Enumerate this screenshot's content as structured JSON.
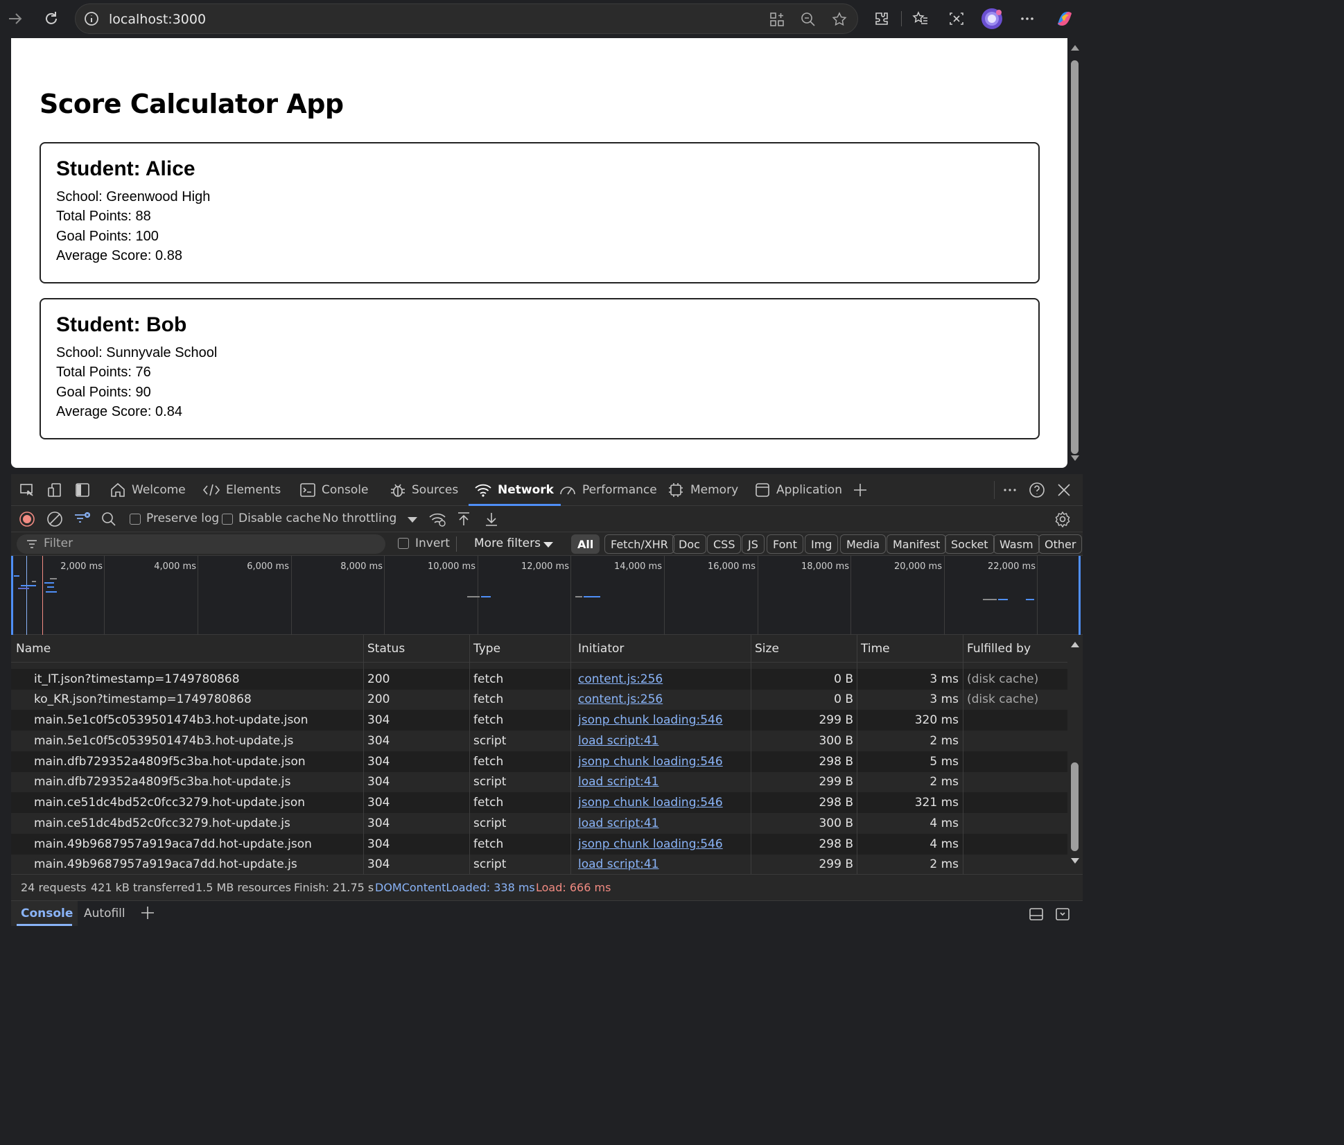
{
  "browser": {
    "url": "localhost:3000",
    "icons": [
      "forward-icon",
      "reload-icon",
      "site-info-icon",
      "app-grid-icon",
      "zoom-out-icon",
      "favorite-star-icon",
      "extensions-icon",
      "favorites-icon",
      "screenshot-icon",
      "profile-avatar",
      "more-icon",
      "copilot-icon"
    ]
  },
  "page": {
    "title": "Score Calculator App",
    "students": [
      {
        "heading": "Student: Alice",
        "school": "School: Greenwood High",
        "total": "Total Points: 88",
        "goal": "Goal Points: 100",
        "average": "Average Score: 0.88"
      },
      {
        "heading": "Student: Bob",
        "school": "School: Sunnyvale School",
        "total": "Total Points: 76",
        "goal": "Goal Points: 90",
        "average": "Average Score: 0.84"
      }
    ]
  },
  "devtools": {
    "tabs": [
      "Welcome",
      "Elements",
      "Console",
      "Sources",
      "Network",
      "Performance",
      "Memory",
      "Application"
    ],
    "active_tab": "Network",
    "toolbar": {
      "preserve_log": "Preserve log",
      "disable_cache": "Disable cache",
      "throttling": "No throttling"
    },
    "filter": {
      "placeholder": "Filter",
      "invert": "Invert",
      "more_filters": "More filters",
      "types": [
        "All",
        "Fetch/XHR",
        "Doc",
        "CSS",
        "JS",
        "Font",
        "Img",
        "Media",
        "Manifest",
        "Socket",
        "Wasm",
        "Other"
      ],
      "active_type": "All"
    },
    "overview": {
      "ticks": [
        "2,000 ms",
        "4,000 ms",
        "6,000 ms",
        "8,000 ms",
        "10,000 ms",
        "12,000 ms",
        "14,000 ms",
        "16,000 ms",
        "18,000 ms",
        "20,000 ms",
        "22,000 ms"
      ]
    },
    "columns": [
      "Name",
      "Status",
      "Type",
      "Initiator",
      "Size",
      "Time",
      "Fulfilled by"
    ],
    "rows": [
      {
        "name": "it_IT.json?timestamp=1749780868",
        "status": "200",
        "type": "fetch",
        "initiator": "content.js:256",
        "size": "0 B",
        "time": "3 ms",
        "fulfilled": "(disk cache)"
      },
      {
        "name": "ko_KR.json?timestamp=1749780868",
        "status": "200",
        "type": "fetch",
        "initiator": "content.js:256",
        "size": "0 B",
        "time": "3 ms",
        "fulfilled": "(disk cache)"
      },
      {
        "name": "main.5e1c0f5c0539501474b3.hot-update.json",
        "status": "304",
        "type": "fetch",
        "initiator": "jsonp chunk loading:546",
        "size": "299 B",
        "time": "320 ms",
        "fulfilled": ""
      },
      {
        "name": "main.5e1c0f5c0539501474b3.hot-update.js",
        "status": "304",
        "type": "script",
        "initiator": "load script:41",
        "size": "300 B",
        "time": "2 ms",
        "fulfilled": ""
      },
      {
        "name": "main.dfb729352a4809f5c3ba.hot-update.json",
        "status": "304",
        "type": "fetch",
        "initiator": "jsonp chunk loading:546",
        "size": "298 B",
        "time": "5 ms",
        "fulfilled": ""
      },
      {
        "name": "main.dfb729352a4809f5c3ba.hot-update.js",
        "status": "304",
        "type": "script",
        "initiator": "load script:41",
        "size": "299 B",
        "time": "2 ms",
        "fulfilled": ""
      },
      {
        "name": "main.ce51dc4bd52c0fcc3279.hot-update.json",
        "status": "304",
        "type": "fetch",
        "initiator": "jsonp chunk loading:546",
        "size": "298 B",
        "time": "321 ms",
        "fulfilled": ""
      },
      {
        "name": "main.ce51dc4bd52c0fcc3279.hot-update.js",
        "status": "304",
        "type": "script",
        "initiator": "load script:41",
        "size": "300 B",
        "time": "4 ms",
        "fulfilled": ""
      },
      {
        "name": "main.49b9687957a919aca7dd.hot-update.json",
        "status": "304",
        "type": "fetch",
        "initiator": "jsonp chunk loading:546",
        "size": "298 B",
        "time": "4 ms",
        "fulfilled": ""
      },
      {
        "name": "main.49b9687957a919aca7dd.hot-update.js",
        "status": "304",
        "type": "script",
        "initiator": "load script:41",
        "size": "299 B",
        "time": "2 ms",
        "fulfilled": ""
      }
    ],
    "summary": {
      "requests": "24 requests",
      "transferred": "421 kB transferred",
      "resources": "1.5 MB resources",
      "finish": "Finish: 21.75 s",
      "dcl": "DOMContentLoaded: 338 ms",
      "load": "Load: 666 ms"
    },
    "drawer": {
      "tabs": [
        "Console",
        "Autofill"
      ],
      "active": "Console"
    },
    "colors": {
      "accent": "#4f8ff7",
      "link": "#8ab4f8",
      "dcl": "#8ab4f8",
      "load": "#f28b82"
    }
  }
}
